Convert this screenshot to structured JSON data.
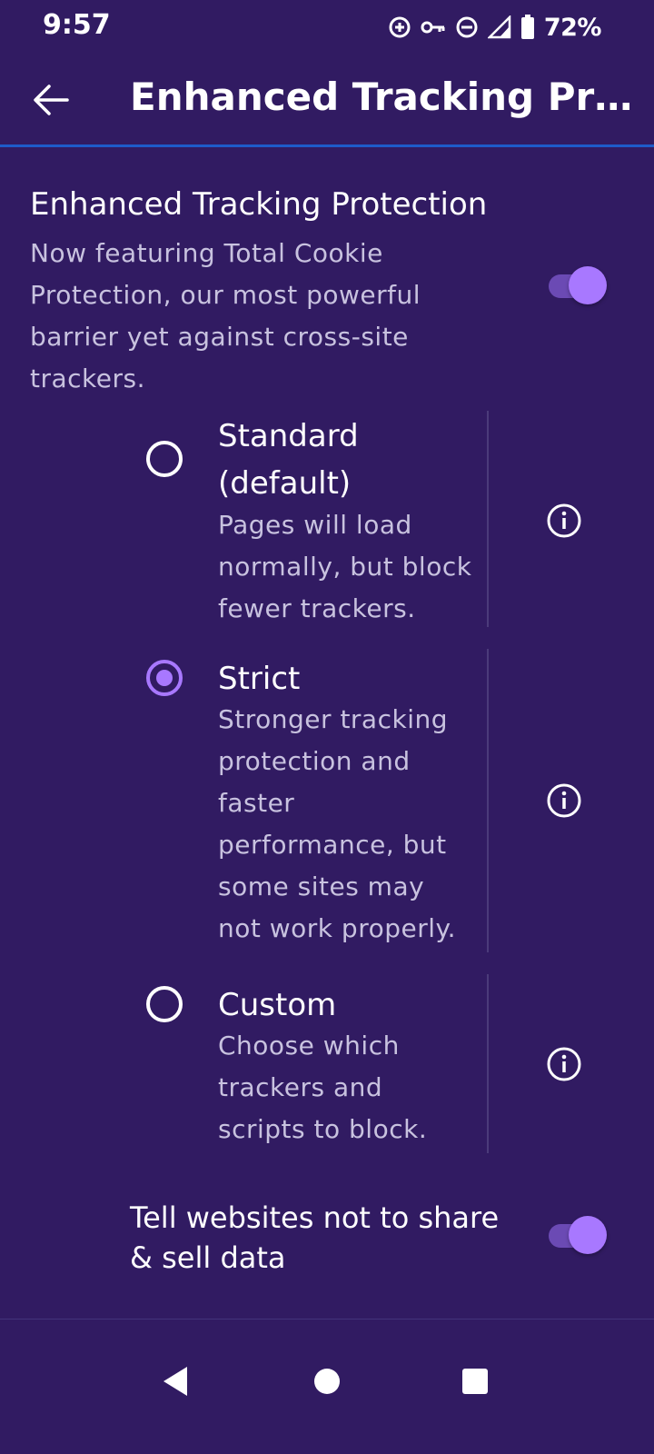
{
  "status_bar": {
    "time": "9:57",
    "battery_percent": "72%",
    "icons": [
      "data-saver-icon",
      "vpn-key-icon",
      "do-not-disturb-icon",
      "cell-signal-icon",
      "battery-icon"
    ]
  },
  "header": {
    "title": "Enhanced Tracking Pr…",
    "back_icon": "arrow-left-icon"
  },
  "etp": {
    "title": "Enhanced Tracking Protection",
    "description": "Now featuring Total Cookie Protection, our most powerful barrier yet against cross-site trackers.",
    "enabled": true
  },
  "options": [
    {
      "title": "Standard (default)",
      "description": "Pages will load normally, but block fewer trackers.",
      "selected": false,
      "info_icon": "info-icon"
    },
    {
      "title": "Strict",
      "description": "Stronger tracking protection and faster performance, but some sites may not work properly.",
      "selected": true,
      "info_icon": "info-icon"
    },
    {
      "title": "Custom",
      "description": "Choose which trackers and scripts to block.",
      "selected": false,
      "info_icon": "info-icon"
    }
  ],
  "gpc": {
    "label": "Tell websites not to share & sell data",
    "enabled": true
  },
  "nav_bar": {
    "back_icon": "nav-back-icon",
    "home_icon": "nav-home-icon",
    "recents_icon": "nav-recents-icon"
  },
  "colors": {
    "background": "#311b62",
    "accent": "#a878ff",
    "divider_blue": "#1e5bc9"
  }
}
